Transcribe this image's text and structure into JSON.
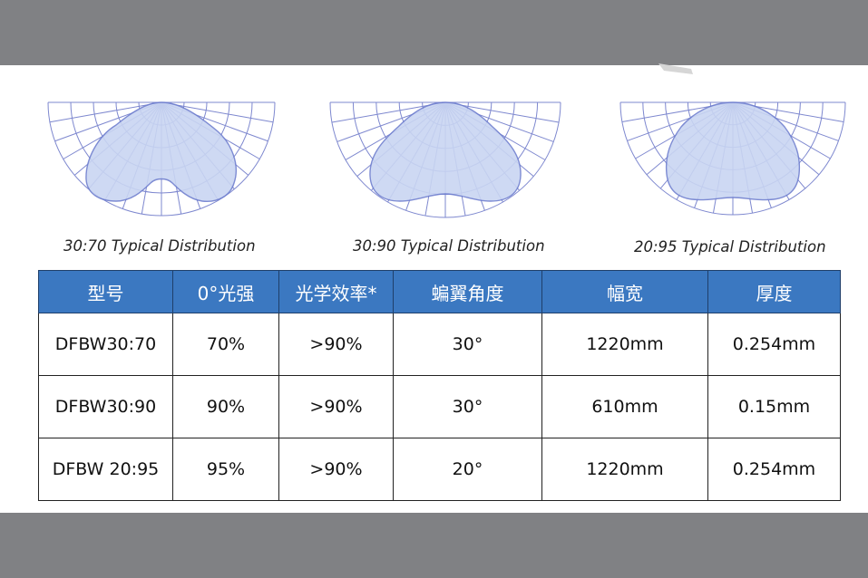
{
  "diagrams": [
    {
      "caption": "30:70 Typical Distribution"
    },
    {
      "caption": "30:90 Typical Distribution"
    },
    {
      "caption": "20:95 Typical Distribution"
    }
  ],
  "colors": {
    "header_bg": "#3b78c1",
    "grid_line": "#7e88cf",
    "curve_fill": "#c9d5f2",
    "curve_stroke": "#6f7fcf",
    "background_band": "#808184"
  },
  "table": {
    "headers": [
      "型号",
      "0°光强",
      "光学效率*",
      "蝙翼角度",
      "幅宽",
      "厚度"
    ],
    "rows": [
      [
        "DFBW30:70",
        "70%",
        ">90%",
        "30°",
        "1220mm",
        "0.254mm"
      ],
      [
        "DFBW30:90",
        "90%",
        ">90%",
        "30°",
        "610mm",
        "0.15mm"
      ],
      [
        "DFBW 20:95",
        "95%",
        ">90%",
        "20°",
        "1220mm",
        "0.254mm"
      ]
    ]
  }
}
